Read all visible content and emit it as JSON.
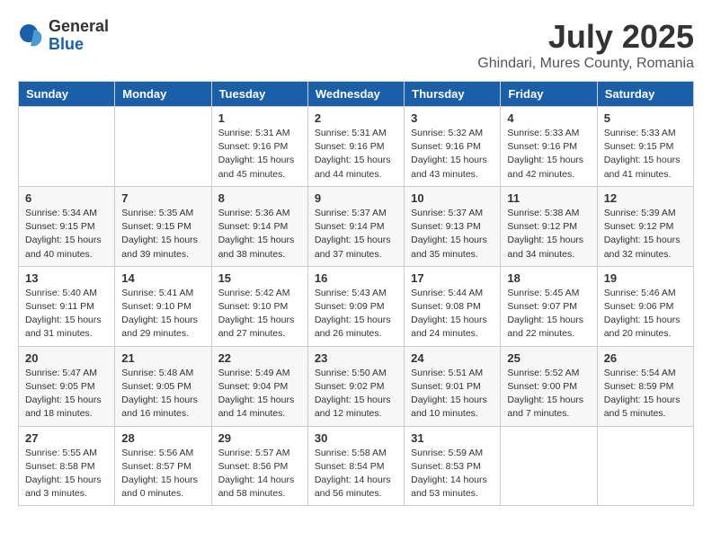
{
  "header": {
    "logo_general": "General",
    "logo_blue": "Blue",
    "month_title": "July 2025",
    "subtitle": "Ghindari, Mures County, Romania"
  },
  "days_of_week": [
    "Sunday",
    "Monday",
    "Tuesday",
    "Wednesday",
    "Thursday",
    "Friday",
    "Saturday"
  ],
  "weeks": [
    [
      {
        "day": "",
        "info": ""
      },
      {
        "day": "",
        "info": ""
      },
      {
        "day": "1",
        "info": "Sunrise: 5:31 AM\nSunset: 9:16 PM\nDaylight: 15 hours\nand 45 minutes."
      },
      {
        "day": "2",
        "info": "Sunrise: 5:31 AM\nSunset: 9:16 PM\nDaylight: 15 hours\nand 44 minutes."
      },
      {
        "day": "3",
        "info": "Sunrise: 5:32 AM\nSunset: 9:16 PM\nDaylight: 15 hours\nand 43 minutes."
      },
      {
        "day": "4",
        "info": "Sunrise: 5:33 AM\nSunset: 9:16 PM\nDaylight: 15 hours\nand 42 minutes."
      },
      {
        "day": "5",
        "info": "Sunrise: 5:33 AM\nSunset: 9:15 PM\nDaylight: 15 hours\nand 41 minutes."
      }
    ],
    [
      {
        "day": "6",
        "info": "Sunrise: 5:34 AM\nSunset: 9:15 PM\nDaylight: 15 hours\nand 40 minutes."
      },
      {
        "day": "7",
        "info": "Sunrise: 5:35 AM\nSunset: 9:15 PM\nDaylight: 15 hours\nand 39 minutes."
      },
      {
        "day": "8",
        "info": "Sunrise: 5:36 AM\nSunset: 9:14 PM\nDaylight: 15 hours\nand 38 minutes."
      },
      {
        "day": "9",
        "info": "Sunrise: 5:37 AM\nSunset: 9:14 PM\nDaylight: 15 hours\nand 37 minutes."
      },
      {
        "day": "10",
        "info": "Sunrise: 5:37 AM\nSunset: 9:13 PM\nDaylight: 15 hours\nand 35 minutes."
      },
      {
        "day": "11",
        "info": "Sunrise: 5:38 AM\nSunset: 9:12 PM\nDaylight: 15 hours\nand 34 minutes."
      },
      {
        "day": "12",
        "info": "Sunrise: 5:39 AM\nSunset: 9:12 PM\nDaylight: 15 hours\nand 32 minutes."
      }
    ],
    [
      {
        "day": "13",
        "info": "Sunrise: 5:40 AM\nSunset: 9:11 PM\nDaylight: 15 hours\nand 31 minutes."
      },
      {
        "day": "14",
        "info": "Sunrise: 5:41 AM\nSunset: 9:10 PM\nDaylight: 15 hours\nand 29 minutes."
      },
      {
        "day": "15",
        "info": "Sunrise: 5:42 AM\nSunset: 9:10 PM\nDaylight: 15 hours\nand 27 minutes."
      },
      {
        "day": "16",
        "info": "Sunrise: 5:43 AM\nSunset: 9:09 PM\nDaylight: 15 hours\nand 26 minutes."
      },
      {
        "day": "17",
        "info": "Sunrise: 5:44 AM\nSunset: 9:08 PM\nDaylight: 15 hours\nand 24 minutes."
      },
      {
        "day": "18",
        "info": "Sunrise: 5:45 AM\nSunset: 9:07 PM\nDaylight: 15 hours\nand 22 minutes."
      },
      {
        "day": "19",
        "info": "Sunrise: 5:46 AM\nSunset: 9:06 PM\nDaylight: 15 hours\nand 20 minutes."
      }
    ],
    [
      {
        "day": "20",
        "info": "Sunrise: 5:47 AM\nSunset: 9:05 PM\nDaylight: 15 hours\nand 18 minutes."
      },
      {
        "day": "21",
        "info": "Sunrise: 5:48 AM\nSunset: 9:05 PM\nDaylight: 15 hours\nand 16 minutes."
      },
      {
        "day": "22",
        "info": "Sunrise: 5:49 AM\nSunset: 9:04 PM\nDaylight: 15 hours\nand 14 minutes."
      },
      {
        "day": "23",
        "info": "Sunrise: 5:50 AM\nSunset: 9:02 PM\nDaylight: 15 hours\nand 12 minutes."
      },
      {
        "day": "24",
        "info": "Sunrise: 5:51 AM\nSunset: 9:01 PM\nDaylight: 15 hours\nand 10 minutes."
      },
      {
        "day": "25",
        "info": "Sunrise: 5:52 AM\nSunset: 9:00 PM\nDaylight: 15 hours\nand 7 minutes."
      },
      {
        "day": "26",
        "info": "Sunrise: 5:54 AM\nSunset: 8:59 PM\nDaylight: 15 hours\nand 5 minutes."
      }
    ],
    [
      {
        "day": "27",
        "info": "Sunrise: 5:55 AM\nSunset: 8:58 PM\nDaylight: 15 hours\nand 3 minutes."
      },
      {
        "day": "28",
        "info": "Sunrise: 5:56 AM\nSunset: 8:57 PM\nDaylight: 15 hours\nand 0 minutes."
      },
      {
        "day": "29",
        "info": "Sunrise: 5:57 AM\nSunset: 8:56 PM\nDaylight: 14 hours\nand 58 minutes."
      },
      {
        "day": "30",
        "info": "Sunrise: 5:58 AM\nSunset: 8:54 PM\nDaylight: 14 hours\nand 56 minutes."
      },
      {
        "day": "31",
        "info": "Sunrise: 5:59 AM\nSunset: 8:53 PM\nDaylight: 14 hours\nand 53 minutes."
      },
      {
        "day": "",
        "info": ""
      },
      {
        "day": "",
        "info": ""
      }
    ]
  ]
}
